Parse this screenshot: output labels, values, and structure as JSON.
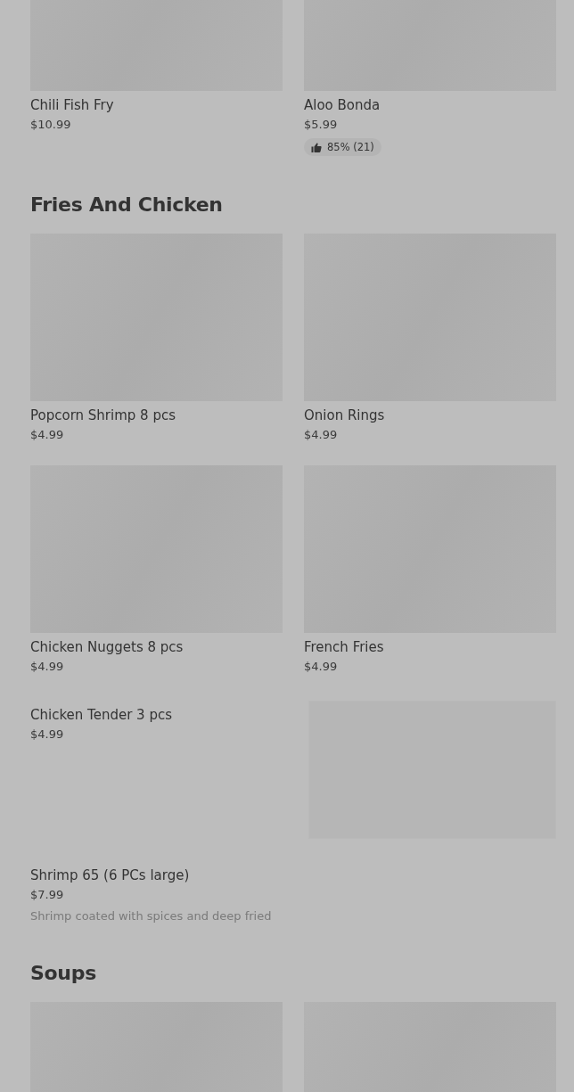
{
  "sections": [
    {
      "items": [
        {
          "kind": "tile",
          "name": "Chili Fish Fry",
          "price": "$10.99"
        },
        {
          "kind": "tile",
          "name": "Aloo Bonda",
          "price": "$5.99",
          "rating": "85% (21)"
        }
      ]
    },
    {
      "title": "Fries And Chicken",
      "items": [
        {
          "kind": "tile",
          "name": "Popcorn Shrimp 8 pcs",
          "price": "$4.99"
        },
        {
          "kind": "tile",
          "name": "Onion Rings",
          "price": "$4.99"
        },
        {
          "kind": "tile",
          "name": "Chicken Nuggets 8 pcs",
          "price": "$4.99"
        },
        {
          "kind": "tile",
          "name": "French Fries",
          "price": "$4.99"
        },
        {
          "kind": "row",
          "name": "Chicken Tender 3 pcs",
          "price": "$4.99",
          "has_image": true
        },
        {
          "kind": "row",
          "name": "Shrimp 65 (6 PCs large)",
          "price": "$7.99",
          "description": "Shrimp coated with spices and deep fried",
          "has_image": false
        }
      ]
    },
    {
      "title": "Soups",
      "items": [
        {
          "kind": "tile"
        },
        {
          "kind": "tile"
        }
      ]
    }
  ]
}
